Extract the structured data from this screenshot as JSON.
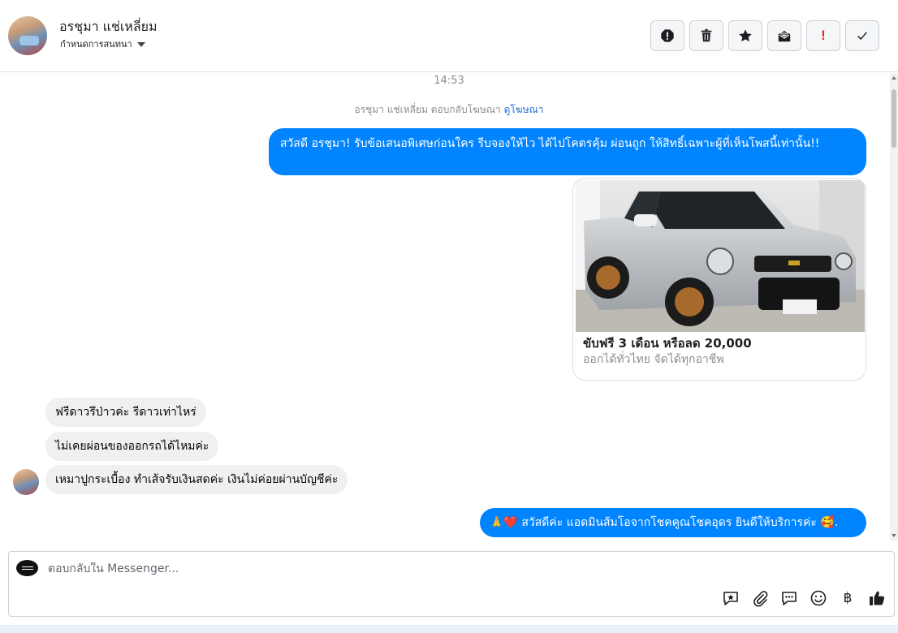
{
  "header": {
    "user_name": "อรชุมา แช่เหลี่ยม",
    "assign_label": "กำหนดการสนทนา",
    "actions": [
      "alert-icon",
      "trash-icon",
      "star-icon",
      "mail-icon",
      "priority-icon",
      "check-icon"
    ],
    "priority_symbol": "!"
  },
  "chat": {
    "timestamp": "14:53",
    "replied_note": "อรชุมา แช่เหลี่ยม ตอบกลับโฆษณา",
    "view_ad_link": "ดูโฆษณา",
    "outgoing_1": "สวัสดี อรชุมา! รับข้อเสนอพิเศษก่อนใคร รีบจองให้ไว ได้ไปโคตรคุ้ม ผ่อนถูก ให้สิทธิ์เฉพาะผู้ที่เห็นโพสนี้เท่านั้น!!",
    "ad_card": {
      "title": "ขับฟรี 3 เดือน หรือลด 20,000",
      "subtitle": "ออกได้ทั่วไทย จัดได้ทุกอาชีพ"
    },
    "incoming": [
      "ฟรีดาวรึป่าวค่ะ รีดาวเท่าไหร่",
      "ไม่เคยผ่อนของออกรถได้ไหมค่ะ",
      "เหมาปูกระเบื้อง ทำเส้จรับเงินสดค่ะ เงินไม่ค่อยผ่านบัญชีค่ะ"
    ],
    "outgoing_2": "🙏❤️ สวัสดีค่ะ แอดมินส้มโอจากโชคคูณโชคอุดร ยินดีให้บริการค่ะ 🥰."
  },
  "composer": {
    "placeholder": "ตอบกลับใน Messenger...",
    "tools": [
      "saved-reply-icon",
      "attachment-icon",
      "chat-bubbles-icon",
      "emoji-icon",
      "baht-icon",
      "like-icon"
    ],
    "baht_symbol": "฿"
  },
  "colors": {
    "outgoing_bubble": "#0084ff",
    "incoming_bubble": "#f0f0f0",
    "link": "#216fdb"
  }
}
